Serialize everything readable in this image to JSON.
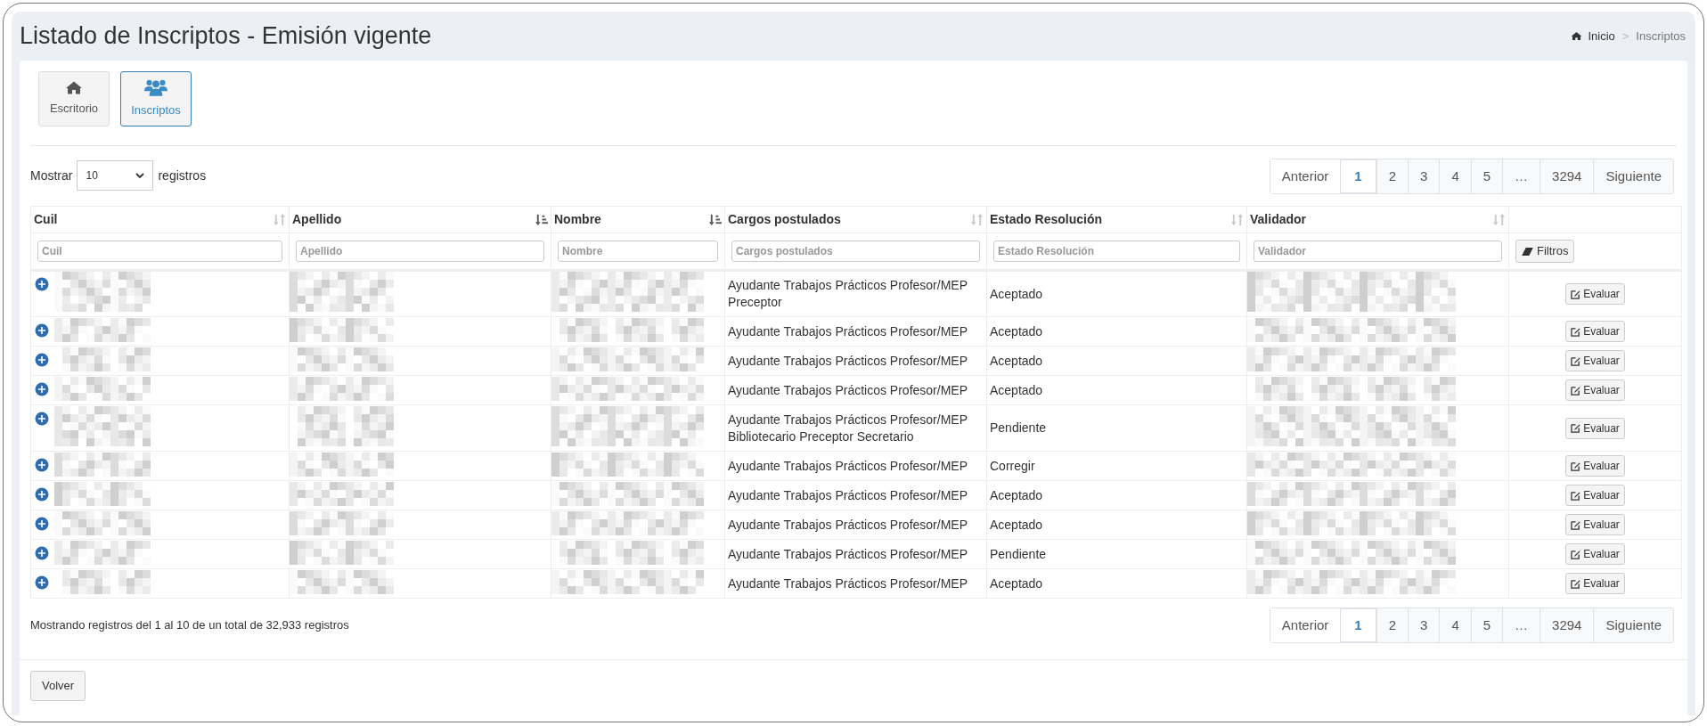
{
  "header": {
    "title": "Listado de Inscriptos - Emisión vigente",
    "breadcrumb": [
      {
        "label": "Inicio",
        "kind": "home"
      },
      {
        "label": ">",
        "kind": "separator"
      },
      {
        "label": "Inscriptos",
        "kind": "current"
      }
    ]
  },
  "nav_buttons": [
    {
      "label": "Escritorio",
      "kind": "home",
      "selected": false
    },
    {
      "label": "Inscriptos",
      "kind": "users",
      "selected": true
    }
  ],
  "length_control": {
    "prefix": "Mostrar",
    "value": "10",
    "suffix": "registros"
  },
  "top_pagination": [
    {
      "label": "Anterior",
      "selected": false
    },
    {
      "label": "1",
      "selected": true
    },
    {
      "label": "2",
      "selected": false
    },
    {
      "label": "3",
      "selected": false
    },
    {
      "label": "4",
      "selected": false
    },
    {
      "label": "5",
      "selected": false
    },
    {
      "label": "…",
      "selected": false
    },
    {
      "label": "3294",
      "selected": false
    },
    {
      "label": "Siguiente",
      "selected": false
    }
  ],
  "table": {
    "columns": [
      {
        "label": "Cuil",
        "sorted": false,
        "placeholder": "Cuil"
      },
      {
        "label": "Apellido",
        "sorted": true,
        "placeholder": "Apellido"
      },
      {
        "label": "Nombre",
        "sorted": true,
        "placeholder": "Nombre"
      },
      {
        "label": "Cargos postulados",
        "sorted": false,
        "placeholder": "Cargos postulados"
      },
      {
        "label": "Estado Resolución",
        "sorted": false,
        "placeholder": "Estado Resolución"
      },
      {
        "label": "Validador",
        "sorted": false,
        "placeholder": "Validador"
      }
    ],
    "filter_button": "Filtros",
    "rows": [
      {
        "cargos": [
          "Ayudante Trabajos Prácticos Profesor/MEP",
          "Preceptor"
        ],
        "estado": "Aceptado",
        "action": "Evaluar"
      },
      {
        "cargos": [
          "Ayudante Trabajos Prácticos Profesor/MEP"
        ],
        "estado": "Aceptado",
        "action": "Evaluar"
      },
      {
        "cargos": [
          "Ayudante Trabajos Prácticos Profesor/MEP"
        ],
        "estado": "Aceptado",
        "action": "Evaluar"
      },
      {
        "cargos": [
          "Ayudante Trabajos Prácticos Profesor/MEP"
        ],
        "estado": "Aceptado",
        "action": "Evaluar"
      },
      {
        "cargos": [
          "Ayudante Trabajos Prácticos Profesor/MEP",
          "Bibliotecario Preceptor Secretario"
        ],
        "estado": "Pendiente",
        "action": "Evaluar"
      },
      {
        "cargos": [
          "Ayudante Trabajos Prácticos Profesor/MEP"
        ],
        "estado": "Corregir",
        "action": "Evaluar"
      },
      {
        "cargos": [
          "Ayudante Trabajos Prácticos Profesor/MEP"
        ],
        "estado": "Aceptado",
        "action": "Evaluar"
      },
      {
        "cargos": [
          "Ayudante Trabajos Prácticos Profesor/MEP"
        ],
        "estado": "Aceptado",
        "action": "Evaluar"
      },
      {
        "cargos": [
          "Ayudante Trabajos Prácticos Profesor/MEP"
        ],
        "estado": "Pendiente",
        "action": "Evaluar"
      },
      {
        "cargos": [
          "Ayudante Trabajos Prácticos Profesor/MEP"
        ],
        "estado": "Aceptado",
        "action": "Evaluar"
      }
    ]
  },
  "info": "Mostrando registros del 1 al 10 de un total de 32,933 registros",
  "bottom_pagination": [
    {
      "label": "Anterior",
      "selected": false
    },
    {
      "label": "1",
      "selected": true
    },
    {
      "label": "2",
      "selected": false
    },
    {
      "label": "3",
      "selected": false
    },
    {
      "label": "4",
      "selected": false
    },
    {
      "label": "5",
      "selected": false
    },
    {
      "label": "…",
      "selected": false
    },
    {
      "label": "3294",
      "selected": false
    },
    {
      "label": "Siguiente",
      "selected": false
    }
  ],
  "back_button": "Volver"
}
